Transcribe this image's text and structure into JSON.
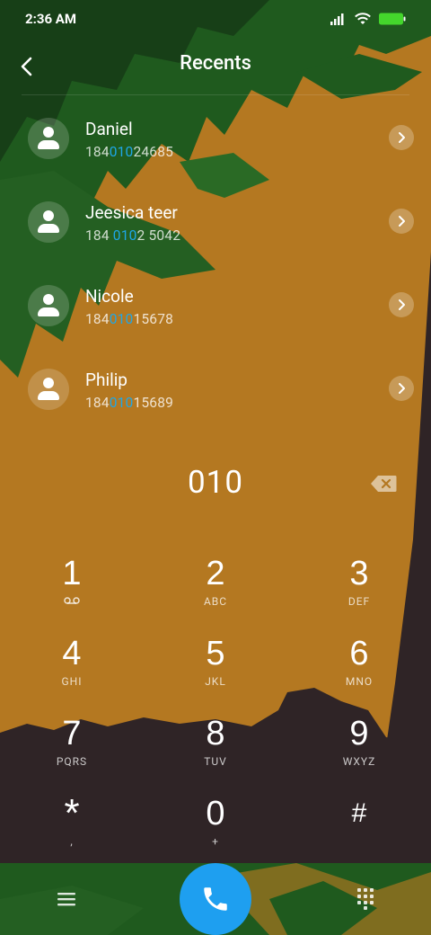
{
  "status_bar": {
    "time": "2:36 AM",
    "icons": [
      "signal-icon",
      "wifi-icon",
      "battery-icon"
    ]
  },
  "header": {
    "title": "Recents",
    "back_icon": "chevron-left-icon"
  },
  "contacts": [
    {
      "name": "Daniel",
      "number_prefix": "184",
      "number_match": "010",
      "number_suffix": "24685"
    },
    {
      "name": "Jeesica teer",
      "number_prefix": "184 ",
      "number_match": "010",
      "number_suffix": "2 5042"
    },
    {
      "name": "Nicole",
      "number_prefix": "184",
      "number_match": "010",
      "number_suffix": "15678"
    },
    {
      "name": "Philip",
      "number_prefix": "184",
      "number_match": "010",
      "number_suffix": "15689"
    }
  ],
  "dialer": {
    "input": "010"
  },
  "keypad": {
    "k1": {
      "digit": "1",
      "letters": ""
    },
    "k2": {
      "digit": "2",
      "letters": "ABC"
    },
    "k3": {
      "digit": "3",
      "letters": "DEF"
    },
    "k4": {
      "digit": "4",
      "letters": "GHI"
    },
    "k5": {
      "digit": "5",
      "letters": "JKL"
    },
    "k6": {
      "digit": "6",
      "letters": "MNO"
    },
    "k7": {
      "digit": "7",
      "letters": "PQRS"
    },
    "k8": {
      "digit": "8",
      "letters": "TUV"
    },
    "k9": {
      "digit": "9",
      "letters": "WXYZ"
    },
    "kstar": {
      "digit": "*",
      "letters": ","
    },
    "k0": {
      "digit": "0",
      "letters": "+"
    },
    "khash": {
      "digit": "#",
      "letters": ""
    }
  },
  "colors": {
    "accent": "#1e9ff0",
    "match": "#1ea7e8",
    "wallpaper_sand": "#b47821",
    "wallpaper_leaf": "#1f5a1e",
    "wallpaper_ground": "#2f2426"
  }
}
